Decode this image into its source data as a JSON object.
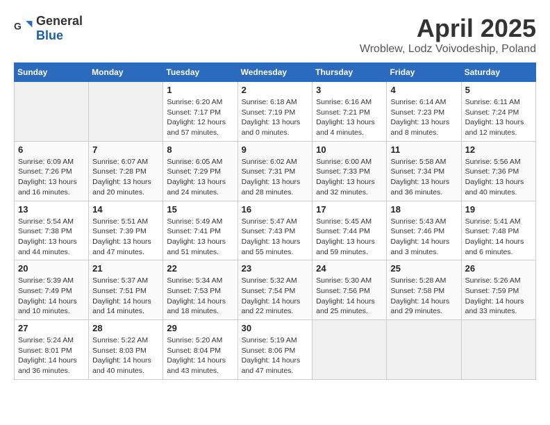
{
  "header": {
    "logo_general": "General",
    "logo_blue": "Blue",
    "month_year": "April 2025",
    "location": "Wroblew, Lodz Voivodeship, Poland"
  },
  "weekdays": [
    "Sunday",
    "Monday",
    "Tuesday",
    "Wednesday",
    "Thursday",
    "Friday",
    "Saturday"
  ],
  "weeks": [
    [
      null,
      null,
      {
        "day": "1",
        "sunrise": "Sunrise: 6:20 AM",
        "sunset": "Sunset: 7:17 PM",
        "daylight": "Daylight: 12 hours and 57 minutes."
      },
      {
        "day": "2",
        "sunrise": "Sunrise: 6:18 AM",
        "sunset": "Sunset: 7:19 PM",
        "daylight": "Daylight: 13 hours and 0 minutes."
      },
      {
        "day": "3",
        "sunrise": "Sunrise: 6:16 AM",
        "sunset": "Sunset: 7:21 PM",
        "daylight": "Daylight: 13 hours and 4 minutes."
      },
      {
        "day": "4",
        "sunrise": "Sunrise: 6:14 AM",
        "sunset": "Sunset: 7:23 PM",
        "daylight": "Daylight: 13 hours and 8 minutes."
      },
      {
        "day": "5",
        "sunrise": "Sunrise: 6:11 AM",
        "sunset": "Sunset: 7:24 PM",
        "daylight": "Daylight: 13 hours and 12 minutes."
      }
    ],
    [
      {
        "day": "6",
        "sunrise": "Sunrise: 6:09 AM",
        "sunset": "Sunset: 7:26 PM",
        "daylight": "Daylight: 13 hours and 16 minutes."
      },
      {
        "day": "7",
        "sunrise": "Sunrise: 6:07 AM",
        "sunset": "Sunset: 7:28 PM",
        "daylight": "Daylight: 13 hours and 20 minutes."
      },
      {
        "day": "8",
        "sunrise": "Sunrise: 6:05 AM",
        "sunset": "Sunset: 7:29 PM",
        "daylight": "Daylight: 13 hours and 24 minutes."
      },
      {
        "day": "9",
        "sunrise": "Sunrise: 6:02 AM",
        "sunset": "Sunset: 7:31 PM",
        "daylight": "Daylight: 13 hours and 28 minutes."
      },
      {
        "day": "10",
        "sunrise": "Sunrise: 6:00 AM",
        "sunset": "Sunset: 7:33 PM",
        "daylight": "Daylight: 13 hours and 32 minutes."
      },
      {
        "day": "11",
        "sunrise": "Sunrise: 5:58 AM",
        "sunset": "Sunset: 7:34 PM",
        "daylight": "Daylight: 13 hours and 36 minutes."
      },
      {
        "day": "12",
        "sunrise": "Sunrise: 5:56 AM",
        "sunset": "Sunset: 7:36 PM",
        "daylight": "Daylight: 13 hours and 40 minutes."
      }
    ],
    [
      {
        "day": "13",
        "sunrise": "Sunrise: 5:54 AM",
        "sunset": "Sunset: 7:38 PM",
        "daylight": "Daylight: 13 hours and 44 minutes."
      },
      {
        "day": "14",
        "sunrise": "Sunrise: 5:51 AM",
        "sunset": "Sunset: 7:39 PM",
        "daylight": "Daylight: 13 hours and 47 minutes."
      },
      {
        "day": "15",
        "sunrise": "Sunrise: 5:49 AM",
        "sunset": "Sunset: 7:41 PM",
        "daylight": "Daylight: 13 hours and 51 minutes."
      },
      {
        "day": "16",
        "sunrise": "Sunrise: 5:47 AM",
        "sunset": "Sunset: 7:43 PM",
        "daylight": "Daylight: 13 hours and 55 minutes."
      },
      {
        "day": "17",
        "sunrise": "Sunrise: 5:45 AM",
        "sunset": "Sunset: 7:44 PM",
        "daylight": "Daylight: 13 hours and 59 minutes."
      },
      {
        "day": "18",
        "sunrise": "Sunrise: 5:43 AM",
        "sunset": "Sunset: 7:46 PM",
        "daylight": "Daylight: 14 hours and 3 minutes."
      },
      {
        "day": "19",
        "sunrise": "Sunrise: 5:41 AM",
        "sunset": "Sunset: 7:48 PM",
        "daylight": "Daylight: 14 hours and 6 minutes."
      }
    ],
    [
      {
        "day": "20",
        "sunrise": "Sunrise: 5:39 AM",
        "sunset": "Sunset: 7:49 PM",
        "daylight": "Daylight: 14 hours and 10 minutes."
      },
      {
        "day": "21",
        "sunrise": "Sunrise: 5:37 AM",
        "sunset": "Sunset: 7:51 PM",
        "daylight": "Daylight: 14 hours and 14 minutes."
      },
      {
        "day": "22",
        "sunrise": "Sunrise: 5:34 AM",
        "sunset": "Sunset: 7:53 PM",
        "daylight": "Daylight: 14 hours and 18 minutes."
      },
      {
        "day": "23",
        "sunrise": "Sunrise: 5:32 AM",
        "sunset": "Sunset: 7:54 PM",
        "daylight": "Daylight: 14 hours and 22 minutes."
      },
      {
        "day": "24",
        "sunrise": "Sunrise: 5:30 AM",
        "sunset": "Sunset: 7:56 PM",
        "daylight": "Daylight: 14 hours and 25 minutes."
      },
      {
        "day": "25",
        "sunrise": "Sunrise: 5:28 AM",
        "sunset": "Sunset: 7:58 PM",
        "daylight": "Daylight: 14 hours and 29 minutes."
      },
      {
        "day": "26",
        "sunrise": "Sunrise: 5:26 AM",
        "sunset": "Sunset: 7:59 PM",
        "daylight": "Daylight: 14 hours and 33 minutes."
      }
    ],
    [
      {
        "day": "27",
        "sunrise": "Sunrise: 5:24 AM",
        "sunset": "Sunset: 8:01 PM",
        "daylight": "Daylight: 14 hours and 36 minutes."
      },
      {
        "day": "28",
        "sunrise": "Sunrise: 5:22 AM",
        "sunset": "Sunset: 8:03 PM",
        "daylight": "Daylight: 14 hours and 40 minutes."
      },
      {
        "day": "29",
        "sunrise": "Sunrise: 5:20 AM",
        "sunset": "Sunset: 8:04 PM",
        "daylight": "Daylight: 14 hours and 43 minutes."
      },
      {
        "day": "30",
        "sunrise": "Sunrise: 5:19 AM",
        "sunset": "Sunset: 8:06 PM",
        "daylight": "Daylight: 14 hours and 47 minutes."
      },
      null,
      null,
      null
    ]
  ]
}
